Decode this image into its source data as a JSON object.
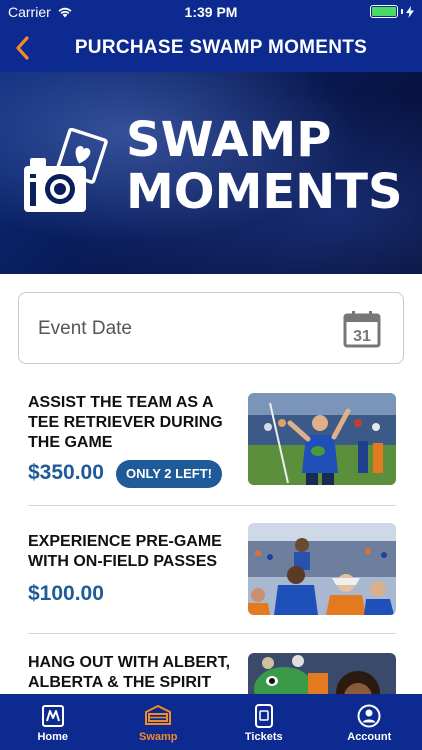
{
  "status_bar": {
    "carrier": "Carrier",
    "time": "1:39 PM"
  },
  "nav": {
    "title": "PURCHASE SWAMP MOMENTS",
    "back_icon": "chevron-left-icon"
  },
  "hero": {
    "line1": "SWAMP",
    "line2": "MOMENTS",
    "icon": "camera-icon"
  },
  "event_date": {
    "placeholder": "Event Date",
    "calendar_day": "31"
  },
  "moments": [
    {
      "title": "ASSIST THE TEAM AS A TEE RETRIEVER DURING THE GAME",
      "price": "$350.00",
      "badge": "ONLY 2 LEFT!"
    },
    {
      "title": "EXPERIENCE PRE-GAME WITH ON-FIELD PASSES",
      "price": "$100.00"
    },
    {
      "title": "HANG OUT WITH ALBERT, ALBERTA & THE SPIRIT"
    }
  ],
  "tabs": [
    {
      "label": "Home",
      "icon": "home-icon",
      "active": false
    },
    {
      "label": "Swamp",
      "icon": "swamp-icon",
      "active": true
    },
    {
      "label": "Tickets",
      "icon": "ticket-icon",
      "active": false
    },
    {
      "label": "Account",
      "icon": "account-icon",
      "active": false
    }
  ],
  "colors": {
    "primary": "#0c2a8f",
    "accent": "#f38a2a",
    "price": "#1f5a99",
    "battery": "#4cd964"
  }
}
